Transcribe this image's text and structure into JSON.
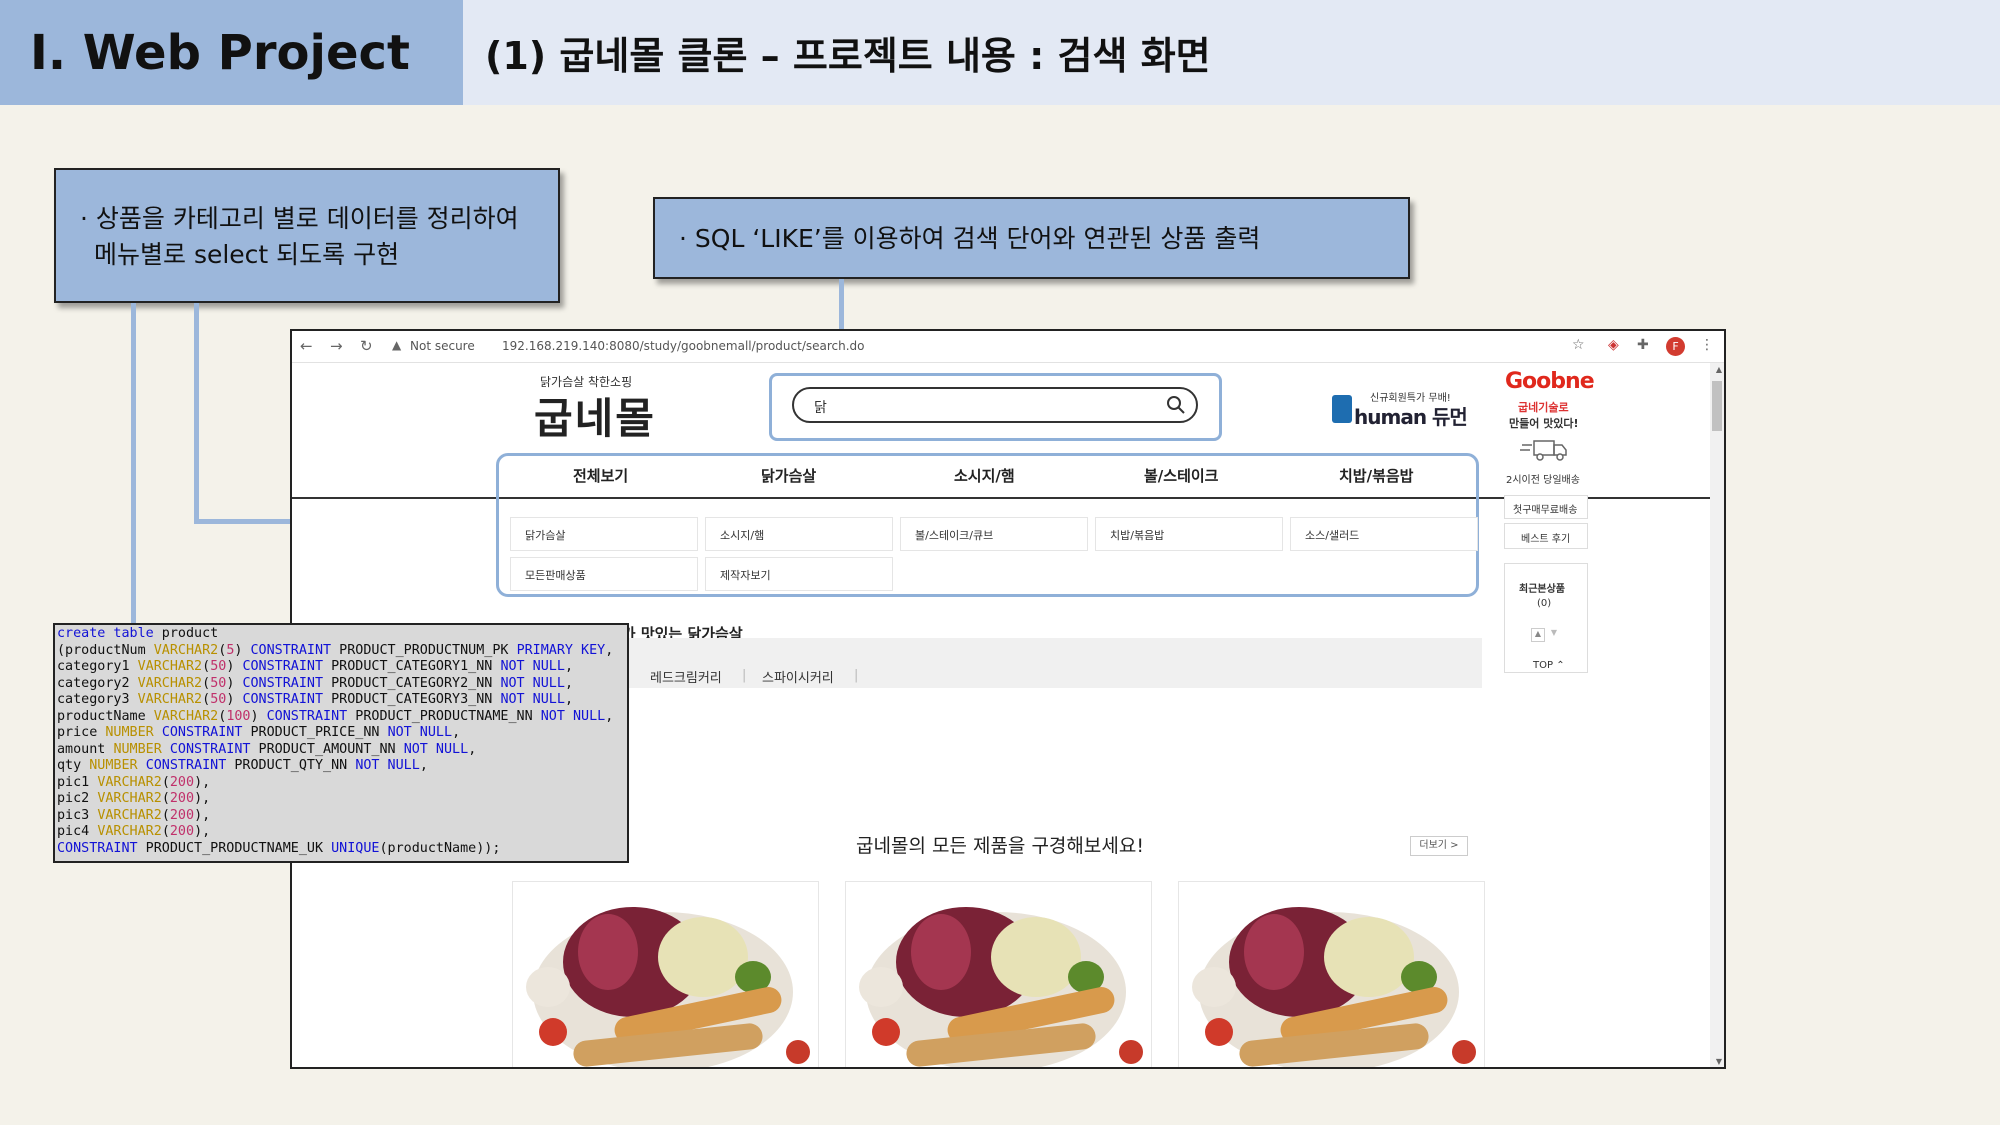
{
  "slide": {
    "section": "Ⅰ. Web Project",
    "title": "(1) 굽네몰 클론 – 프로젝트 내용 : 검색 화면"
  },
  "callouts": {
    "category_line1": "· 상품을 카테고리 별로 데이터를 정리하여",
    "category_line2": "메뉴별로 select 되도록 구현",
    "search": "· SQL ‘LIKE’를 이용하여 검색 단어와 연관된 상품 출력"
  },
  "browser": {
    "not_secure": "Not secure",
    "url": "192.168.219.140:8080/study/goobnemall/product/search.do",
    "avatar": "F"
  },
  "site": {
    "logo_small": "닭가슴살 착한소핑",
    "logo_big": "굽네몰",
    "search_value": "닭",
    "banner_sub": "신규회원특가 무배!",
    "banner_main": "human 듀먼",
    "tabs": [
      "전체보기",
      "닭가슴살",
      "소시지/햄",
      "볼/스테이크",
      "치밥/볶음밥"
    ],
    "subcats": [
      "닭가슴살",
      "소시지/햄",
      "볼/스테이크/큐브",
      "치밥/볶음밥",
      "소스/샐러드",
      "모든판매상품",
      "제작자보기"
    ],
    "best_title": "스가 맛있는 닭가슴살",
    "band_items": [
      "레드크림커리",
      "스파이시커리"
    ],
    "all_title": "굽네몰의 모든 제품을 구경해보세요!",
    "more": "더보기 >"
  },
  "side": {
    "brand": "Goobne",
    "tag1": "굽네기술로",
    "tag2": "만들어 맛있다!",
    "delivery": "2시이전 당일배송",
    "free_ship": "첫구매무료배송",
    "review": "베스트 후기",
    "recent": "최근본상품",
    "recent_count": "(0)",
    "top": "TOP ⌃"
  },
  "sql": {
    "lines": [
      "create table product",
      "(productNum VARCHAR2(5) CONSTRAINT PRODUCT_PRODUCTNUM_PK PRIMARY KEY,",
      "category1 VARCHAR2(50) CONSTRAINT PRODUCT_CATEGORY1_NN NOT NULL,",
      "category2 VARCHAR2(50) CONSTRAINT PRODUCT_CATEGORY2_NN NOT NULL,",
      "category3 VARCHAR2(50) CONSTRAINT PRODUCT_CATEGORY3_NN NOT NULL,",
      "productName VARCHAR2(100) CONSTRAINT PRODUCT_PRODUCTNAME_NN NOT NULL,",
      "price NUMBER CONSTRAINT PRODUCT_PRICE_NN NOT NULL,",
      "amount NUMBER CONSTRAINT PRODUCT_AMOUNT_NN NOT NULL,",
      "qty NUMBER CONSTRAINT PRODUCT_QTY_NN NOT NULL,",
      "pic1 VARCHAR2(200),",
      "pic2 VARCHAR2(200),",
      "pic3 VARCHAR2(200),",
      "pic4 VARCHAR2(200),",
      "CONSTRAINT PRODUCT_PRODUCTNAME_UK UNIQUE(productName));"
    ]
  },
  "colors": {
    "accent_blue": "#9cb7db",
    "header_light": "#e3e9f4",
    "highlight_border": "#8fb0d8",
    "goobne_red": "#e0281c"
  }
}
